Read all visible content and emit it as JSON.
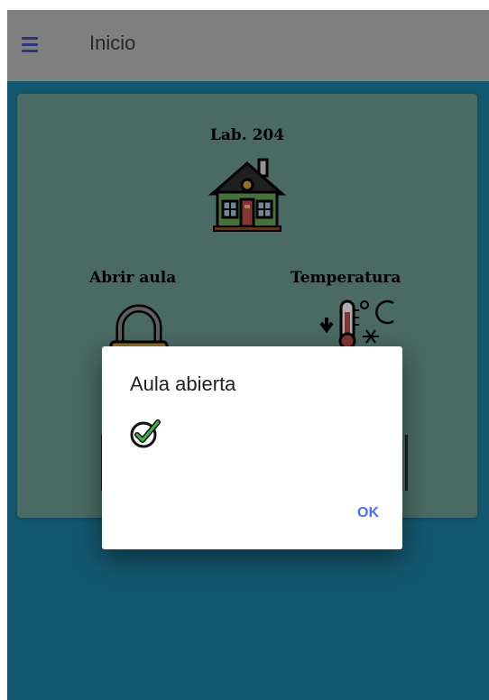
{
  "appbar": {
    "title": "Inicio",
    "menu_icon": "hamburger-menu-icon",
    "accent": "#3f51b5"
  },
  "card": {
    "lab_title": "Lab. 204",
    "lab_icon": "house-icon",
    "actions": [
      {
        "label": "Abrir aula",
        "icon": "padlock-icon"
      },
      {
        "label": "Temperatura",
        "icon": "thermometer-icon"
      }
    ]
  },
  "dialog": {
    "title": "Aula abierta",
    "icon": "check-circle-icon",
    "ok_label": "OK"
  },
  "colors": {
    "appbar_bg": "#bdbdbd",
    "page_bg": "#1c80a3",
    "card_bg": "#6e9d93",
    "dialog_button": "#4c6ef5"
  }
}
